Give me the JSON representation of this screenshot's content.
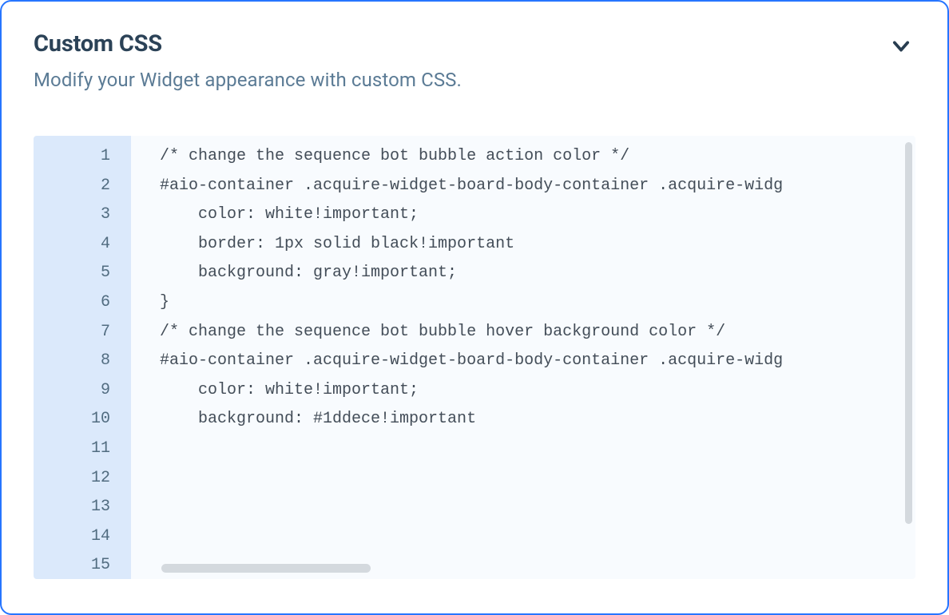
{
  "header": {
    "title": "Custom CSS",
    "subtitle": "Modify your Widget appearance with custom CSS."
  },
  "editor": {
    "total_lines": 15,
    "lines": [
      "/* change the sequence bot bubble action color */",
      "#aio-container .acquire-widget-board-body-container .acquire-widg",
      "    color: white!important;",
      "    border: 1px solid black!important",
      "    background: gray!important;",
      "}",
      "/* change the sequence bot bubble hover background color */",
      "#aio-container .acquire-widget-board-body-container .acquire-widg",
      "    color: white!important;",
      "    background: #1ddece!important",
      "",
      "",
      "",
      "",
      ""
    ]
  }
}
